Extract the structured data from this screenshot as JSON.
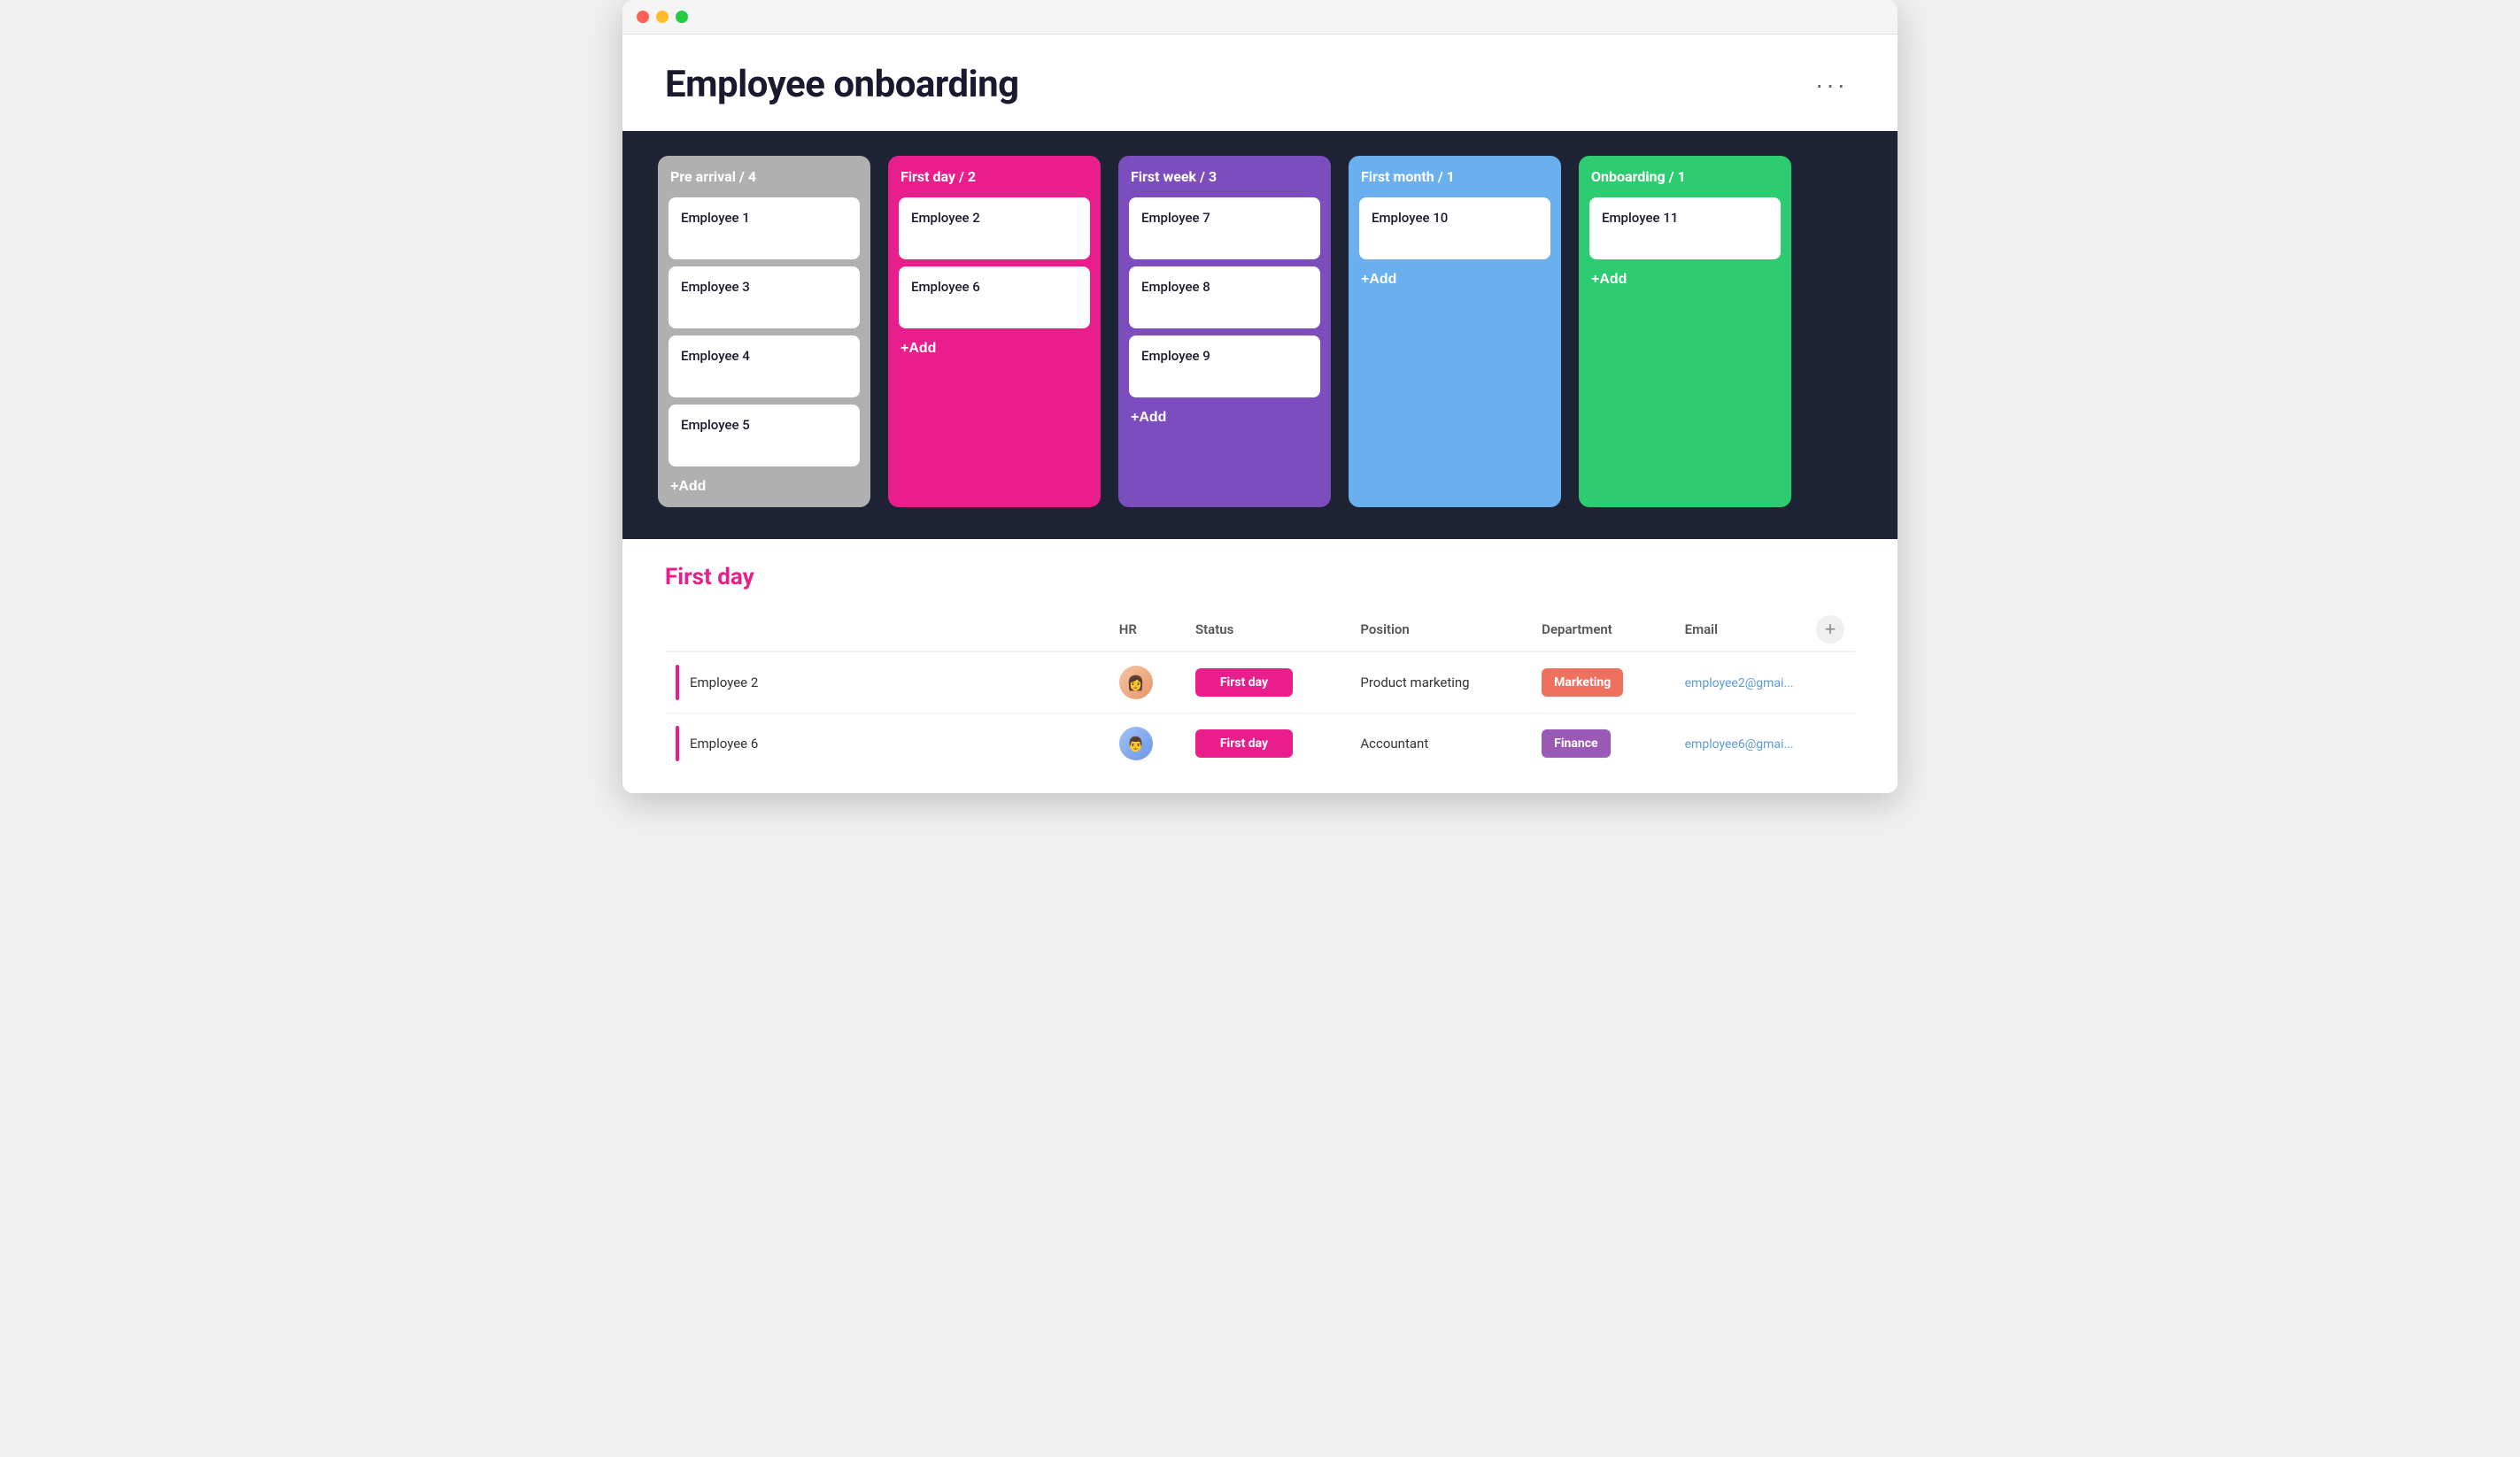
{
  "window": {
    "traffic_lights": [
      "red",
      "yellow",
      "green"
    ]
  },
  "header": {
    "title": "Employee onboarding",
    "more_btn_label": "···"
  },
  "kanban": {
    "columns": [
      {
        "id": "pre-arrival",
        "title": "Pre arrival / 4",
        "color_class": "col-grey",
        "cards": [
          {
            "id": "emp1",
            "name": "Employee 1"
          },
          {
            "id": "emp3",
            "name": "Employee 3"
          },
          {
            "id": "emp4",
            "name": "Employee 4"
          },
          {
            "id": "emp5",
            "name": "Employee 5"
          }
        ],
        "add_label": "+Add"
      },
      {
        "id": "first-day",
        "title": "First day / 2",
        "color_class": "col-pink",
        "cards": [
          {
            "id": "emp2",
            "name": "Employee 2"
          },
          {
            "id": "emp6",
            "name": "Employee 6"
          }
        ],
        "add_label": "+Add"
      },
      {
        "id": "first-week",
        "title": "First week / 3",
        "color_class": "col-purple",
        "cards": [
          {
            "id": "emp7",
            "name": "Employee 7"
          },
          {
            "id": "emp8",
            "name": "Employee 8"
          },
          {
            "id": "emp9",
            "name": "Employee 9"
          }
        ],
        "add_label": "+Add"
      },
      {
        "id": "first-month",
        "title": "First month / 1",
        "color_class": "col-blue",
        "cards": [
          {
            "id": "emp10",
            "name": "Employee 10"
          }
        ],
        "add_label": "+Add"
      },
      {
        "id": "onboarding",
        "title": "Onboarding / 1",
        "color_class": "col-green",
        "cards": [
          {
            "id": "emp11",
            "name": "Employee 11"
          }
        ],
        "add_label": "+Add"
      }
    ]
  },
  "table": {
    "section_title": "First day",
    "columns": [
      "",
      "HR",
      "Status",
      "Position",
      "Department",
      "Email"
    ],
    "rows": [
      {
        "id": "emp2",
        "name": "Employee 2",
        "avatar_type": "woman",
        "status": "First day",
        "status_class": "status-firstday",
        "position": "Product marketing",
        "department": "Marketing",
        "dept_class": "dept-marketing",
        "email": "employee2@gmai..."
      },
      {
        "id": "emp6",
        "name": "Employee 6",
        "avatar_type": "man",
        "status": "First day",
        "status_class": "status-firstday",
        "position": "Accountant",
        "department": "Finance",
        "dept_class": "dept-finance",
        "email": "employee6@gmai..."
      }
    ],
    "add_col_icon": "+"
  }
}
